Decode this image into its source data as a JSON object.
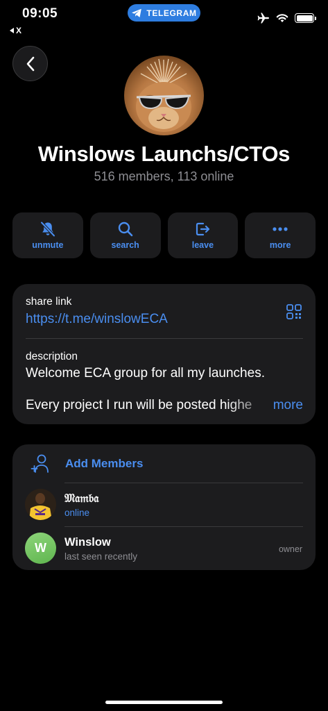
{
  "status_bar": {
    "time": "09:05",
    "back_app": "X",
    "pill_label": "TELEGRAM"
  },
  "header": {
    "back_icon": "chevron-left-icon",
    "group_name": "Winslows Launchs/CTOs",
    "group_subtitle": "516 members, 113 online"
  },
  "actions": [
    {
      "label": "unmute",
      "icon": "bell-slash-icon"
    },
    {
      "label": "search",
      "icon": "search-icon"
    },
    {
      "label": "leave",
      "icon": "leave-icon"
    },
    {
      "label": "more",
      "icon": "more-dots-icon"
    }
  ],
  "info": {
    "share_label": "share link",
    "share_url": "https://t.me/winslowECA",
    "description_label": "description",
    "description_line1": "Welcome ECA group for all my launches.",
    "description_line2": "Every project I run will be posted highe",
    "more_label": "more"
  },
  "members": {
    "add_label": "Add Members",
    "list": [
      {
        "name": "𝔐𝔞𝔪𝔟𝔞",
        "status": "online",
        "role": ""
      },
      {
        "name": "Winslow",
        "status": "last seen recently",
        "role": "owner",
        "initial": "W"
      }
    ]
  },
  "colors": {
    "accent": "#4a8ef0",
    "card": "#1c1c1e",
    "background": "#000000",
    "pill": "#2e7de0",
    "status_online": "#4a8ef0",
    "status_offline": "#8e8e93",
    "winslow_avatar": "#7bc86c"
  }
}
